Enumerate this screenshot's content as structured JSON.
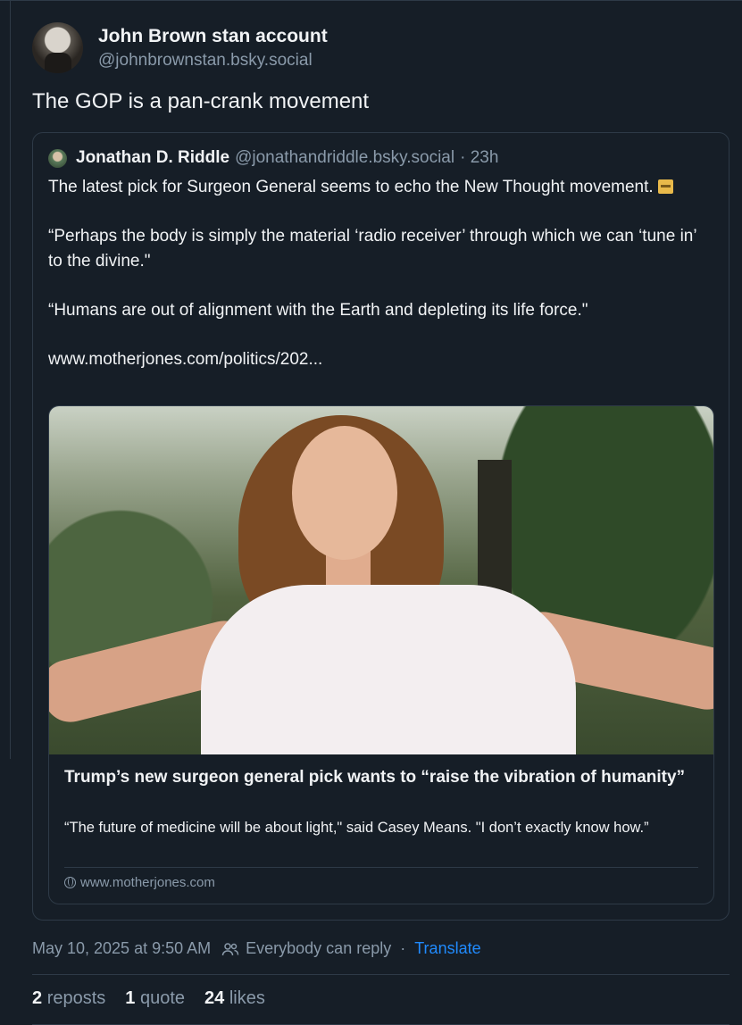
{
  "post": {
    "author_name": "John Brown stan account",
    "author_handle": "@johnbrownstan.bsky.social",
    "text": "The GOP is a pan-crank movement",
    "timestamp": "May 10, 2025 at 9:50 AM",
    "reply_setting": "Everybody can reply",
    "separator": "·",
    "translate_label": "Translate"
  },
  "quote": {
    "author_name": "Jonathan D. Riddle",
    "author_handle": "@jonathandriddle.bsky.social",
    "age": "· 23h",
    "line1": "The latest pick for Surgeon General seems to echo the New Thought movement.",
    "rest": "\n\n“Perhaps the body is simply the material ‘radio receiver’ through which we can ‘tune in’ to the divine.\"\n\n“Humans are out of alignment with the Earth and depleting its life force.\"\n\nwww.motherjones.com/politics/202..."
  },
  "card": {
    "title": "Trump’s new surgeon general pick wants to “raise the vibration of humanity”",
    "description": "“The future of medicine will be about light,\" said Casey Means. \"I don’t exactly know how.”",
    "domain": "www.motherjones.com"
  },
  "stats": {
    "reposts_count": "2",
    "reposts_label": "reposts",
    "quotes_count": "1",
    "quotes_label": "quote",
    "likes_count": "24",
    "likes_label": "likes"
  },
  "colors": {
    "background": "#161e27",
    "accent": "#208bfe",
    "muted_text": "#8a9aaa",
    "border": "#2e3a47"
  },
  "icons": [
    "people-icon",
    "globe-icon",
    "card-box-emoji"
  ]
}
